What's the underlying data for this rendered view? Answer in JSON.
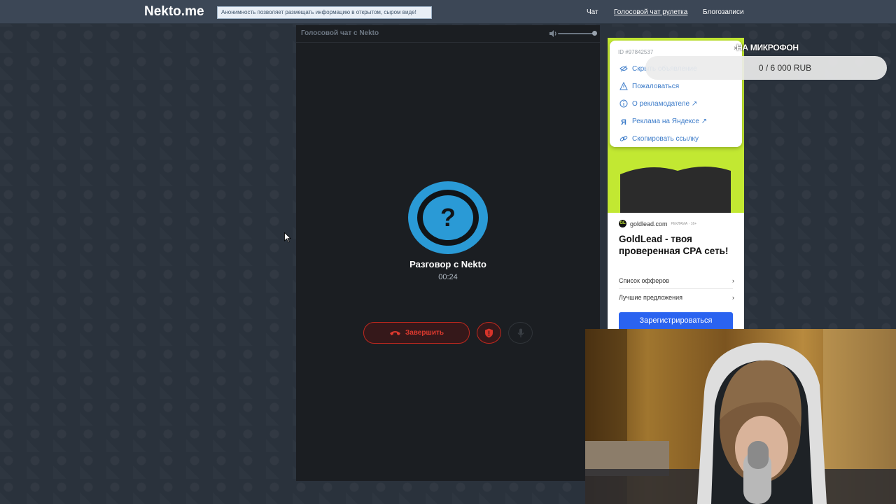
{
  "header": {
    "logo": "Nekto.me",
    "tagline": "Анонимность позволяет размещать информацию в открытом, сыром виде!",
    "nav": [
      {
        "label": "Чат"
      },
      {
        "label": "Голосовой чат рулетка"
      },
      {
        "label": "Блогозаписи"
      }
    ]
  },
  "chat_panel": {
    "title": "Голосовой чат с Nekto",
    "peer_name": "Разговор с Nekto",
    "timer": "00:24",
    "avatar_glyph": "?",
    "end_button_label": "Завершить",
    "icons": {
      "volume": "volume-icon",
      "end_call": "phone-hangup-icon",
      "report": "shield-icon",
      "mic": "microphone-icon"
    }
  },
  "ad": {
    "id_text": "ID #97842537",
    "close": "×",
    "menu": [
      {
        "label": "Скрыть объявление",
        "icon": "eye-off-icon"
      },
      {
        "label": "Пожаловаться",
        "icon": "warning-icon"
      },
      {
        "label": "О рекламодателе ↗",
        "icon": "info-icon"
      },
      {
        "label": "Реклама на Яндексе ↗",
        "icon": "yandex-icon"
      },
      {
        "label": "Скопировать ссылку",
        "icon": "link-icon"
      }
    ],
    "domain": "goldlead.com",
    "badge": "РЕКЛАМА · 16+",
    "headline": "GoldLead - твоя проверенная CPA сеть!",
    "links": [
      {
        "label": "Список офферов",
        "arrow": "›"
      },
      {
        "label": "Лучшие предложения",
        "arrow": "›"
      }
    ],
    "cta": "Зарегистрироваться"
  },
  "overlay": {
    "title": "НА МИКРОФОН",
    "progress": "0 / 6 000 RUB"
  },
  "colors": {
    "header_bg": "#3c4756",
    "panel_bg": "#1b1e22",
    "avatar_blue": "#2a9ad6",
    "danger_red": "#c0281e",
    "ad_accent_green": "#c2e832",
    "ad_link_blue": "#3d7cc9",
    "cta_blue": "#2a63f0"
  }
}
